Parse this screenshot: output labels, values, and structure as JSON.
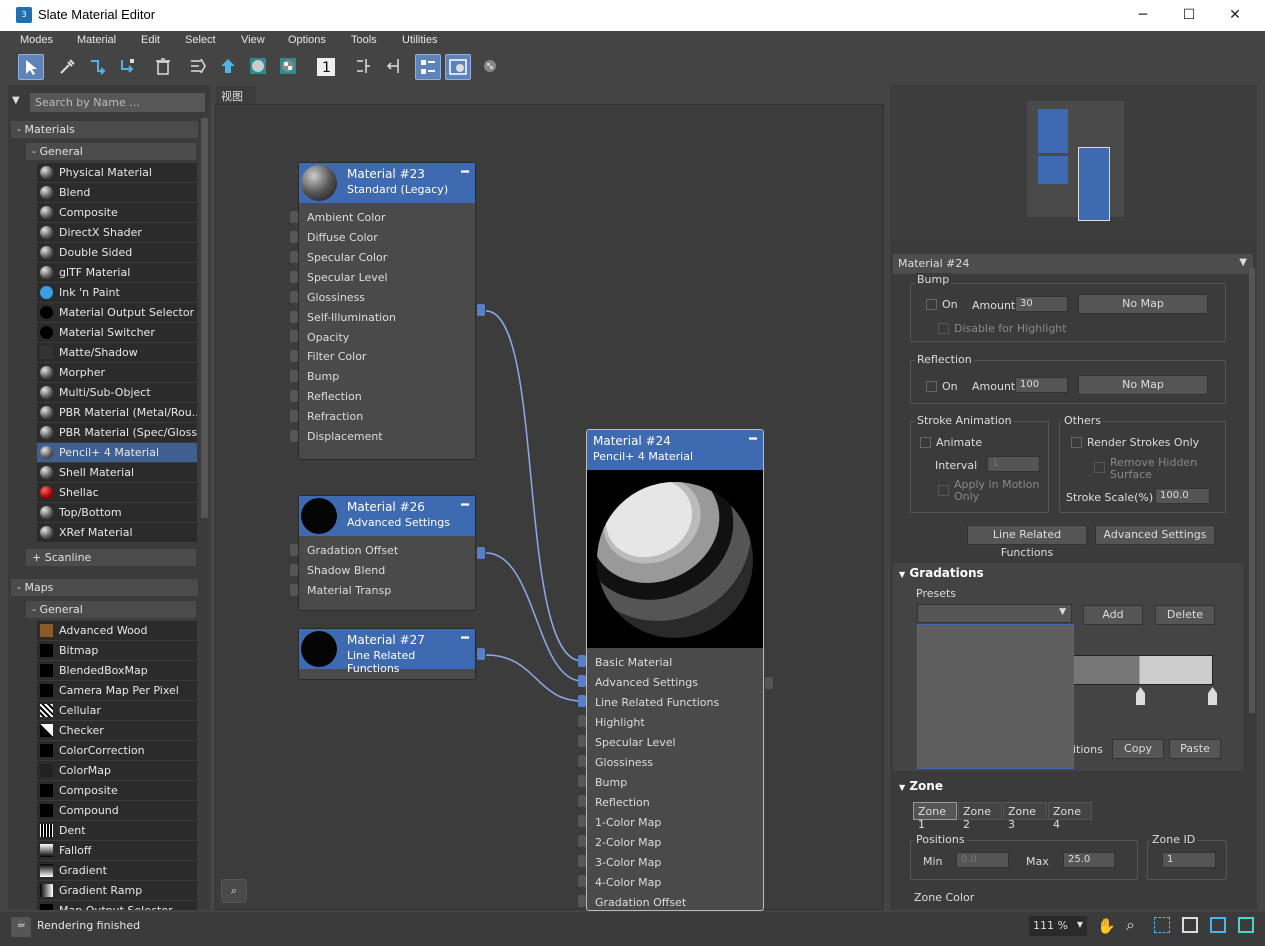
{
  "window": {
    "title": "Slate Material Editor",
    "icon_label": "3",
    "minimize": "─",
    "maximize": "☐",
    "close": "✕"
  },
  "menus": [
    "Modes",
    "Material",
    "Edit",
    "Select",
    "View",
    "Options",
    "Tools",
    "Utilities"
  ],
  "search": {
    "placeholder": "Search by Name ..."
  },
  "browser": {
    "materials_label": "- Materials",
    "general_label": "- General",
    "materials": [
      "Physical Material",
      "Blend",
      "Composite",
      "DirectX Shader",
      "Double Sided",
      "glTF Material",
      "Ink 'n Paint",
      "Material Output Selector",
      "Material Switcher",
      "Matte/Shadow",
      "Morpher",
      "Multi/Sub-Object",
      "PBR Material (Metal/Rou...",
      "PBR Material (Spec/Gloss)",
      "Pencil+ 4 Material",
      "Shell Material",
      "Shellac",
      "Top/Bottom",
      "XRef Material"
    ],
    "selected_material": "Pencil+ 4 Material",
    "scanline_label": "+ Scanline",
    "maps_label": "- Maps",
    "maps_general_label": "- General",
    "maps": [
      "Advanced Wood",
      "Bitmap",
      "BlendedBoxMap",
      "Camera Map Per Pixel",
      "Cellular",
      "Checker",
      "ColorCorrection",
      "ColorMap",
      "Composite",
      "Compound",
      "Dent",
      "Falloff",
      "Gradient",
      "Gradient Ramp",
      "Map Output Selector"
    ]
  },
  "view_tab": "视图 1",
  "nodes": {
    "m23": {
      "name": "Material #23",
      "type": "Standard (Legacy)",
      "slots": [
        "Ambient Color",
        "Diffuse Color",
        "Specular Color",
        "Specular Level",
        "Glossiness",
        "Self-Illumination",
        "Opacity",
        "Filter Color",
        "Bump",
        "Reflection",
        "Refraction",
        "Displacement"
      ]
    },
    "m26": {
      "name": "Material #26",
      "type": "Advanced Settings",
      "slots": [
        "Gradation Offset",
        "Shadow Blend",
        "Material Transp"
      ]
    },
    "m27": {
      "name": "Material #27",
      "type": "Line Related Functions",
      "slots": []
    },
    "m24": {
      "name": "Material #24",
      "type": "Pencil+ 4 Material",
      "slots": [
        "Basic Material",
        "Advanced Settings",
        "Line Related Functions",
        "Highlight",
        "Specular Level",
        "Glossiness",
        "Bump",
        "Reflection",
        "1-Color Map",
        "2-Color Map",
        "3-Color Map",
        "4-Color Map",
        "Gradation Offset"
      ]
    }
  },
  "panel": {
    "material_name": "Material #24",
    "bump": {
      "title": "Bump",
      "on": "On",
      "amount_label": "Amount",
      "amount": "30",
      "map": "No Map",
      "disable": "Disable for Highlight"
    },
    "reflection": {
      "title": "Reflection",
      "on": "On",
      "amount_label": "Amount",
      "amount": "100",
      "map": "No Map"
    },
    "stroke": {
      "title": "Stroke Animation",
      "animate": "Animate",
      "interval_label": "Interval",
      "interval": "1",
      "apply": "Apply in Motion Only"
    },
    "others": {
      "title": "Others",
      "render_strokes": "Render Strokes Only",
      "remove_hidden": "Remove Hidden Surface",
      "scale_label": "Stroke Scale(%)",
      "scale": "100.0"
    },
    "btn_line": "Line Related Functions",
    "btn_adv": "Advanced Settings",
    "gradations": {
      "title": "Gradations",
      "presets": "Presets",
      "add": "Add",
      "delete": "Delete",
      "positions_partial": "itions",
      "copy": "Copy",
      "paste": "Paste"
    },
    "zone": {
      "title": "Zone",
      "tabs": [
        "Zone 1",
        "Zone 2",
        "Zone 3",
        "Zone 4"
      ],
      "positions": "Positions",
      "min_label": "Min",
      "min": "0.0",
      "max_label": "Max",
      "max": "25.0",
      "zone_id_label": "Zone ID",
      "zone_id": "1",
      "zone_color": "Zone Color"
    }
  },
  "status": {
    "text": "Rendering finished",
    "zoom": "111 %"
  }
}
